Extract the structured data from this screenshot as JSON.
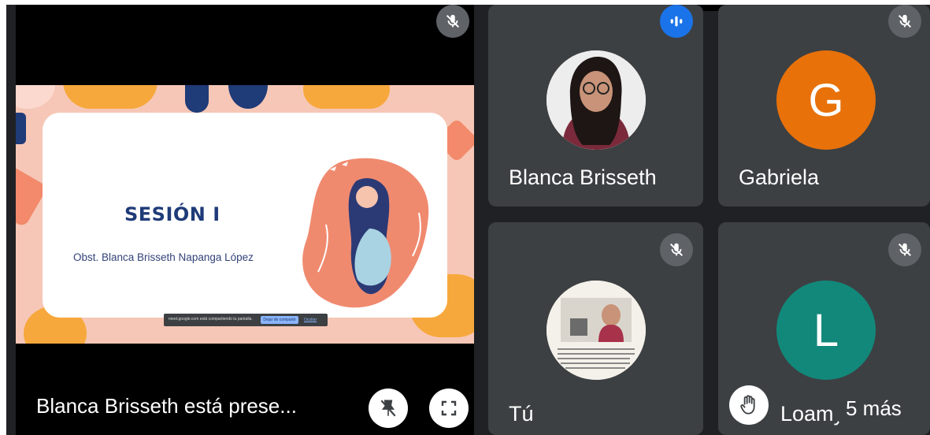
{
  "presentation": {
    "presenter_label": "Blanca Brisseth está prese...",
    "slide_title": "SESIÓN I",
    "slide_subtitle": "Obst. Blanca Brisseth Napanga López",
    "share_bar_text": "meet.google.com está compartiendo tu pantalla.",
    "share_bar_stop": "Dejar de compartir",
    "share_bar_hide": "Ocultar"
  },
  "participants": [
    {
      "name": "Blanca Brisseth",
      "avatar": "photo",
      "status": "speaking"
    },
    {
      "name": "Gabriela",
      "avatar_letter": "G",
      "avatar_color": "#e8710a",
      "status": "muted"
    },
    {
      "name": "Tú",
      "avatar": "photo",
      "status": "muted"
    },
    {
      "name": "Loamy",
      "avatar_letter": "L",
      "avatar_color": "#12887a",
      "status": "muted",
      "hand_raised": true
    }
  ],
  "more_participants": "5 más",
  "icons": {
    "mic_off": "mic-off-icon",
    "speaking": "audio-level-icon",
    "unpin": "unpin-icon",
    "fullscreen": "fullscreen-icon",
    "raise_hand": "raise-hand-icon"
  },
  "colors": {
    "tile_bg": "#3c4043",
    "page_bg": "#202124",
    "accent": "#1a73e8"
  }
}
